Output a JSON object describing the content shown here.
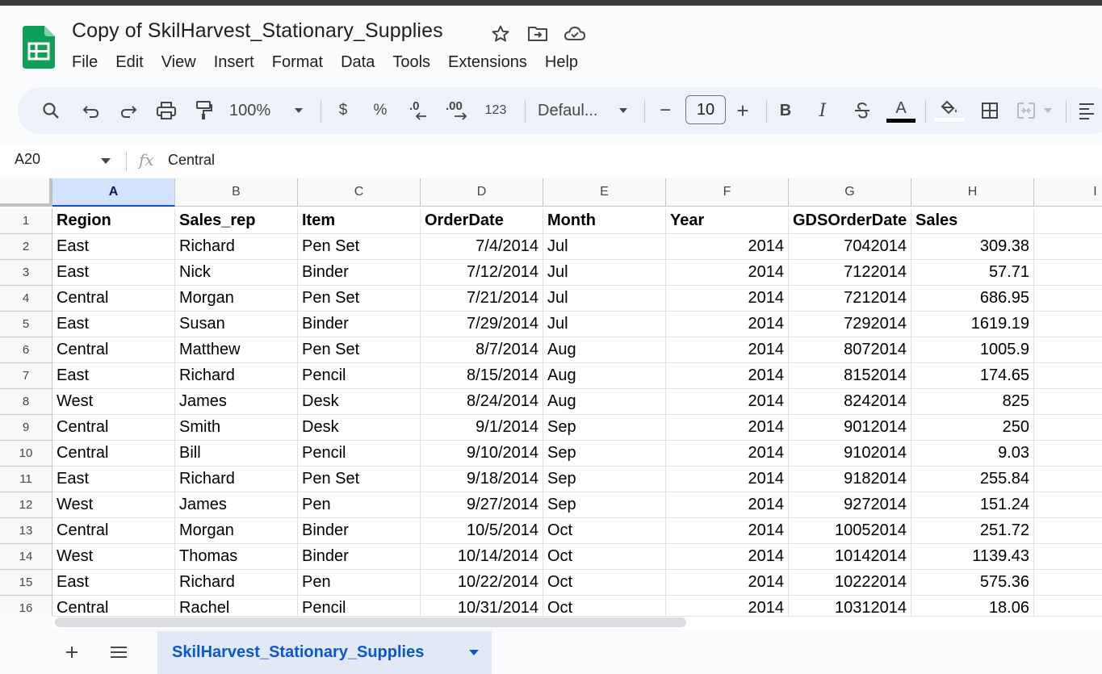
{
  "doc": {
    "title": "Copy of SkilHarvest_Stationary_Supplies"
  },
  "menu": [
    "File",
    "Edit",
    "View",
    "Insert",
    "Format",
    "Data",
    "Tools",
    "Extensions",
    "Help"
  ],
  "toolbar": {
    "zoom": "100%",
    "currency": "$",
    "percent": "%",
    "decrease_decimal": ".0",
    "increase_decimal": ".00",
    "number_format": "123",
    "font": "Defaul...",
    "font_size": "10",
    "minus": "−",
    "plus": "+",
    "bold": "B",
    "italic": "I",
    "text_color": "A"
  },
  "formula_bar": {
    "cell_ref": "A20",
    "fx": "fx",
    "value": "Central"
  },
  "grid": {
    "columns": [
      "A",
      "B",
      "C",
      "D",
      "E",
      "F",
      "G",
      "H",
      "I"
    ],
    "selected_column": "A",
    "rows": [
      {
        "num": "1",
        "cells": [
          "Region",
          "Sales_rep",
          "Item",
          "OrderDate",
          "Month",
          "Year",
          "GDSOrderDate",
          "Sales"
        ]
      },
      {
        "num": "2",
        "cells": [
          "East",
          "Richard",
          "Pen Set",
          "7/4/2014",
          "Jul",
          "2014",
          "7042014",
          "309.38"
        ]
      },
      {
        "num": "3",
        "cells": [
          "East",
          "Nick",
          "Binder",
          "7/12/2014",
          "Jul",
          "2014",
          "7122014",
          "57.71"
        ]
      },
      {
        "num": "4",
        "cells": [
          "Central",
          "Morgan",
          "Pen Set",
          "7/21/2014",
          "Jul",
          "2014",
          "7212014",
          "686.95"
        ]
      },
      {
        "num": "5",
        "cells": [
          "East",
          "Susan",
          "Binder",
          "7/29/2014",
          "Jul",
          "2014",
          "7292014",
          "1619.19"
        ]
      },
      {
        "num": "6",
        "cells": [
          "Central",
          "Matthew",
          "Pen Set",
          "8/7/2014",
          "Aug",
          "2014",
          "8072014",
          "1005.9"
        ]
      },
      {
        "num": "7",
        "cells": [
          "East",
          "Richard",
          "Pencil",
          "8/15/2014",
          "Aug",
          "2014",
          "8152014",
          "174.65"
        ]
      },
      {
        "num": "8",
        "cells": [
          "West",
          "James",
          "Desk",
          "8/24/2014",
          "Aug",
          "2014",
          "8242014",
          "825"
        ]
      },
      {
        "num": "9",
        "cells": [
          "Central",
          "Smith",
          "Desk",
          "9/1/2014",
          "Sep",
          "2014",
          "9012014",
          "250"
        ]
      },
      {
        "num": "10",
        "cells": [
          "Central",
          "Bill",
          "Pencil",
          "9/10/2014",
          "Sep",
          "2014",
          "9102014",
          "9.03"
        ]
      },
      {
        "num": "11",
        "cells": [
          "East",
          "Richard",
          "Pen Set",
          "9/18/2014",
          "Sep",
          "2014",
          "9182014",
          "255.84"
        ]
      },
      {
        "num": "12",
        "cells": [
          "West",
          "James",
          "Pen",
          "9/27/2014",
          "Sep",
          "2014",
          "9272014",
          "151.24"
        ]
      },
      {
        "num": "13",
        "cells": [
          "Central",
          "Morgan",
          "Binder",
          "10/5/2014",
          "Oct",
          "2014",
          "10052014",
          "251.72"
        ]
      },
      {
        "num": "14",
        "cells": [
          "West",
          "Thomas",
          "Binder",
          "10/14/2014",
          "Oct",
          "2014",
          "10142014",
          "1139.43"
        ]
      },
      {
        "num": "15",
        "cells": [
          "East",
          "Richard",
          "Pen",
          "10/22/2014",
          "Oct",
          "2014",
          "10222014",
          "575.36"
        ]
      },
      {
        "num": "16",
        "cells": [
          "Central",
          "Rachel",
          "Pencil",
          "10/31/2014",
          "Oct",
          "2014",
          "10312014",
          "18.06"
        ]
      }
    ]
  },
  "sheets": {
    "active": "SkilHarvest_Stationary_Supplies"
  },
  "colors": {
    "accent": "#0b57d0",
    "sheets_green": "#0f9d58",
    "toolbar_bg": "#edf2fa",
    "selected_header": "#d3e3fd"
  }
}
